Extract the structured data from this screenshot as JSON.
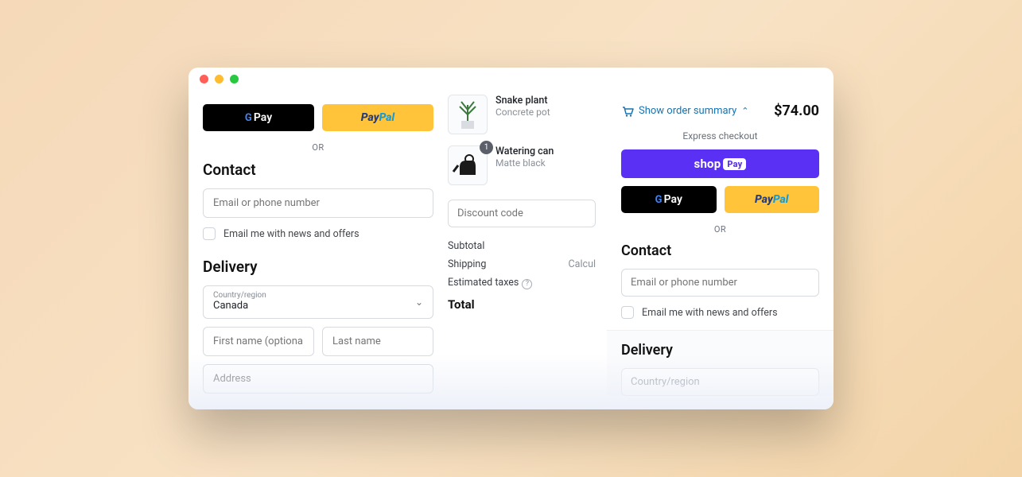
{
  "left": {
    "gpay_label": "Pay",
    "paypal_pay": "Pay",
    "paypal_pal": "Pal",
    "or": "OR",
    "contact_heading": "Contact",
    "email_placeholder": "Email or phone number",
    "news_label": "Email me with news and offers",
    "delivery_heading": "Delivery",
    "country_label": "Country/region",
    "country_value": "Canada",
    "first_name_placeholder": "First name (optional)",
    "last_name_placeholder": "Last name",
    "address_placeholder": "Address"
  },
  "mid": {
    "items": [
      {
        "title": "Snake plant",
        "sub": "Concrete pot"
      },
      {
        "title": "Watering can",
        "sub": "Matte black",
        "badge": "1"
      }
    ],
    "discount_placeholder": "Discount code",
    "subtotal_label": "Subtotal",
    "shipping_label": "Shipping",
    "shipping_value": "Calcul",
    "taxes_label": "Estimated taxes",
    "total_label": "Total"
  },
  "right": {
    "show_summary": "Show order summary",
    "total": "$74.00",
    "express_label": "Express checkout",
    "shop_label": "shop",
    "shop_badge": "Pay",
    "gpay_label": "Pay",
    "paypal_pay": "Pay",
    "paypal_pal": "Pal",
    "or": "OR",
    "contact_heading": "Contact",
    "email_placeholder": "Email or phone number",
    "news_label": "Email me with news and offers",
    "delivery_heading": "Delivery",
    "country_label": "Country/region"
  }
}
